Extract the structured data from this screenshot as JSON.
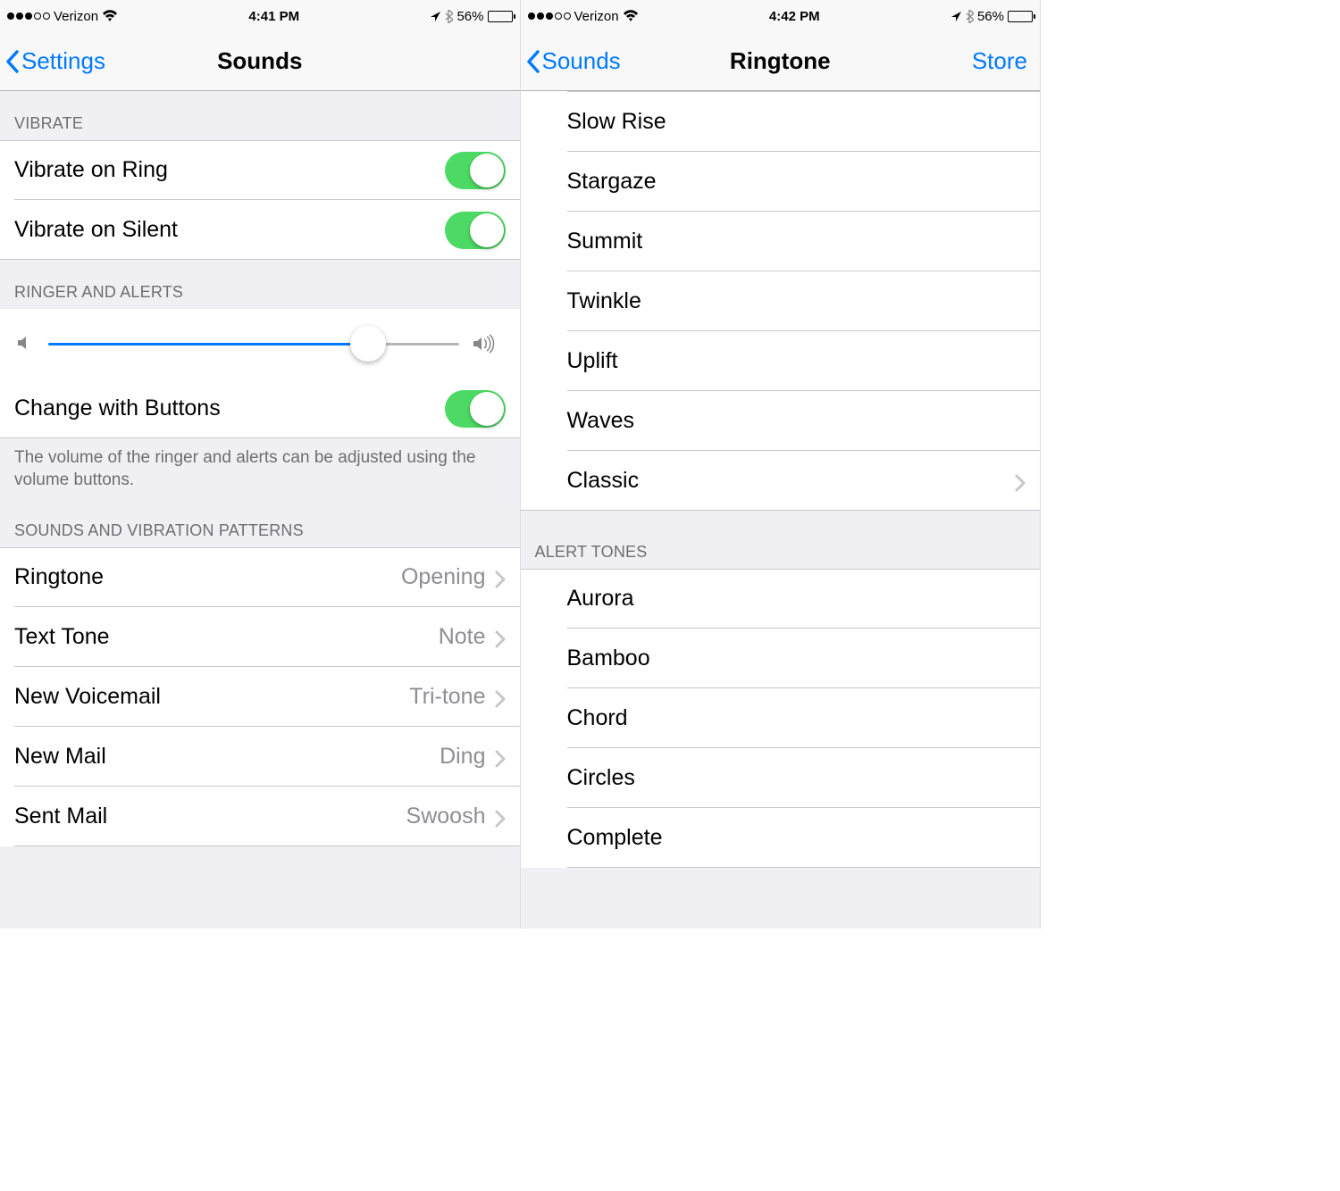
{
  "left": {
    "status": {
      "carrier": "Verizon",
      "time": "4:41 PM",
      "battery_pct": "56%",
      "battery_level_pct": 56,
      "signal_filled": 3,
      "signal_total": 5
    },
    "nav": {
      "back": "Settings",
      "title": "Sounds"
    },
    "sections": {
      "vibrate_header": "Vibrate",
      "vibrate_on_ring": "Vibrate on Ring",
      "vibrate_on_silent": "Vibrate on Silent",
      "ringer_header": "Ringer and Alerts",
      "change_with_buttons": "Change with Buttons",
      "ringer_footer": "The volume of the ringer and alerts can be adjusted using the volume buttons.",
      "patterns_header": "Sounds and Vibration Patterns"
    },
    "slider": {
      "value_pct": 78
    },
    "patterns": [
      {
        "label": "Ringtone",
        "value": "Opening"
      },
      {
        "label": "Text Tone",
        "value": "Note"
      },
      {
        "label": "New Voicemail",
        "value": "Tri-tone"
      },
      {
        "label": "New Mail",
        "value": "Ding"
      },
      {
        "label": "Sent Mail",
        "value": "Swoosh"
      }
    ]
  },
  "right": {
    "status": {
      "carrier": "Verizon",
      "time": "4:42 PM",
      "battery_pct": "56%",
      "battery_level_pct": 56,
      "signal_filled": 3,
      "signal_total": 5
    },
    "nav": {
      "back": "Sounds",
      "title": "Ringtone",
      "right": "Store"
    },
    "ringtones": [
      "Slow Rise",
      "Stargaze",
      "Summit",
      "Twinkle",
      "Uplift",
      "Waves"
    ],
    "classic_label": "Classic",
    "alert_header": "Alert Tones",
    "alert_tones": [
      "Aurora",
      "Bamboo",
      "Chord",
      "Circles",
      "Complete"
    ]
  }
}
